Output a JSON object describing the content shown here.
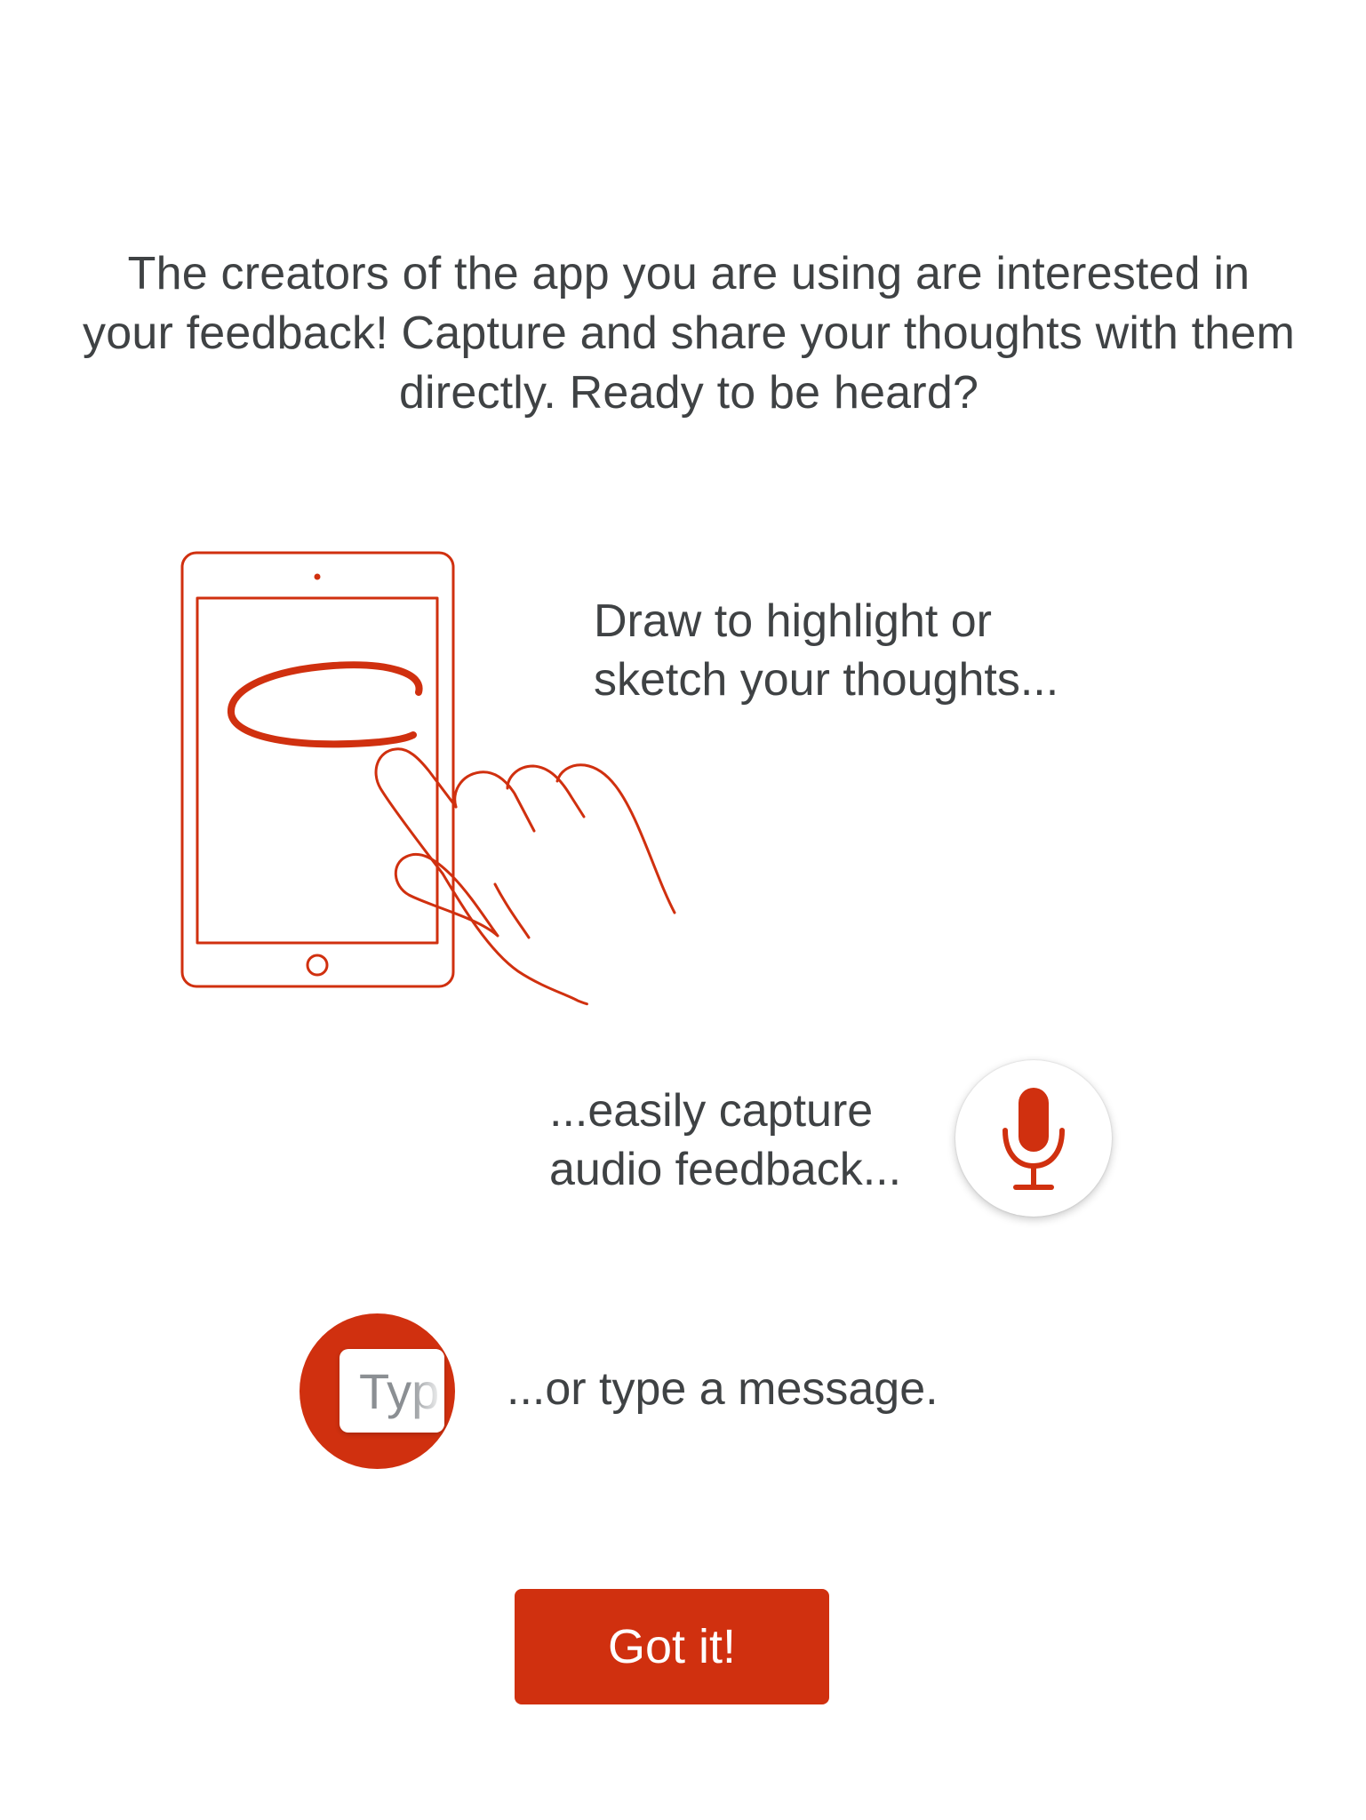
{
  "intro": {
    "text": "The creators of the app you are using are interested in your feedback! Capture and share your thoughts with them directly. Ready to be heard?"
  },
  "features": {
    "draw": {
      "line1": "Draw to highlight or",
      "line2": "sketch your thoughts...",
      "icon": "tablet-drawing-hand-icon"
    },
    "audio": {
      "line1": "...easily capture",
      "line2": "audio feedback...",
      "icon": "microphone-icon"
    },
    "message": {
      "text": "...or type a message.",
      "field_placeholder": "Typ",
      "icon": "text-field-icon"
    }
  },
  "actions": {
    "got_it_label": "Got it!"
  },
  "colors": {
    "accent": "#d0300f",
    "text": "#3f4244",
    "background": "#ffffff",
    "placeholder": "#8b8f93"
  }
}
